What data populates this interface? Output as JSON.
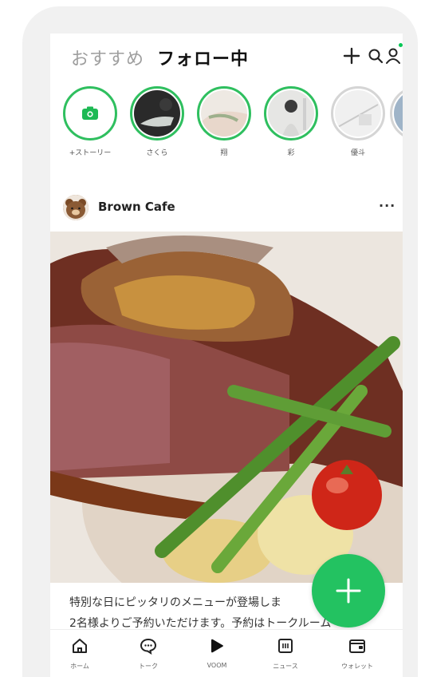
{
  "header": {
    "tab_recommended": "おすすめ",
    "tab_following": "フォロー中",
    "icons": [
      "plus-icon",
      "search-icon",
      "profile-icon"
    ]
  },
  "stories": [
    {
      "label": "+ストーリー",
      "type": "add",
      "icon": "camera-icon"
    },
    {
      "label": "さくら",
      "type": "active"
    },
    {
      "label": "翔",
      "type": "active"
    },
    {
      "label": "彩",
      "type": "active"
    },
    {
      "label": "優斗",
      "type": "seen"
    }
  ],
  "post": {
    "author": "Brown Cafe",
    "more": "···",
    "caption_lines": [
      "特別な日にピッタリのメニューが登場しま",
      "2名様よりご予約いただけます。予約はトークルーム"
    ]
  },
  "nav": [
    {
      "label": "ホーム",
      "icon": "home-icon"
    },
    {
      "label": "トーク",
      "icon": "chat-icon"
    },
    {
      "label": "VOOM",
      "icon": "voom-icon"
    },
    {
      "label": "ニュース",
      "icon": "news-icon"
    },
    {
      "label": "ウォレット",
      "icon": "wallet-icon"
    }
  ],
  "colors": {
    "accent": "#06c755",
    "ring": "#2fbf5f",
    "fab": "#23c261"
  }
}
